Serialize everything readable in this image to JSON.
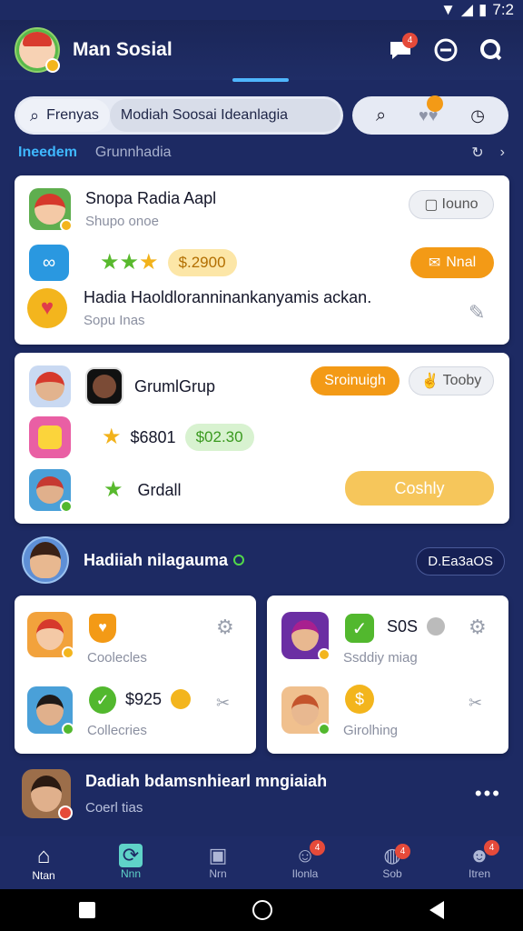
{
  "status_bar": {
    "time": "7:2"
  },
  "header": {
    "title": "Man Sosial",
    "messages_badge": "4"
  },
  "search": {
    "tab_search": "Frenyas",
    "tab_social": "Modiah Soosai Ideanlagia"
  },
  "subbar": {
    "active": "Ineedem",
    "inactive": "Grunnhadia"
  },
  "card1": {
    "title": "Snopa Radia Aapl",
    "subtitle": "Shupo onoe",
    "button_outline": "Iouno",
    "price": "$.2900",
    "button_orange": "Nnal",
    "desc": "Hadia Haoldloranninankanyamis ackan.",
    "desc_sub": "Sopu Inas"
  },
  "card2": {
    "group_name": "GrumlGrup",
    "btn_orange": "Sroinuigh",
    "btn_outline": "Tooby",
    "price1": "$6801",
    "price2": "$02.30",
    "name3": "Grdall",
    "btn_yellow": "Coshly"
  },
  "section": {
    "title": "Hadiiah nilagauma",
    "button": "D.Ea3aOS"
  },
  "mini1": {
    "label_a": "Coolecles",
    "price": "$925",
    "label_b": "Collecries"
  },
  "mini2": {
    "price": "S0S",
    "label_a": "Ssddiy miag",
    "label_b": "Girolhing"
  },
  "feed": {
    "title": "Dadiah bdamsnhiearl mngiaiah",
    "sub": "Coerl tias"
  },
  "nav": [
    {
      "label": "Ntan"
    },
    {
      "label": "Nnn"
    },
    {
      "label": "Nrn"
    },
    {
      "label": "Ilonla",
      "badge": "4"
    },
    {
      "label": "Sob",
      "badge": "4"
    },
    {
      "label": "Itren",
      "badge": "4"
    }
  ],
  "colors": {
    "accent": "#f39a16",
    "navy": "#1d2a63",
    "green": "#52b82e",
    "yellow": "#f6c65b"
  }
}
